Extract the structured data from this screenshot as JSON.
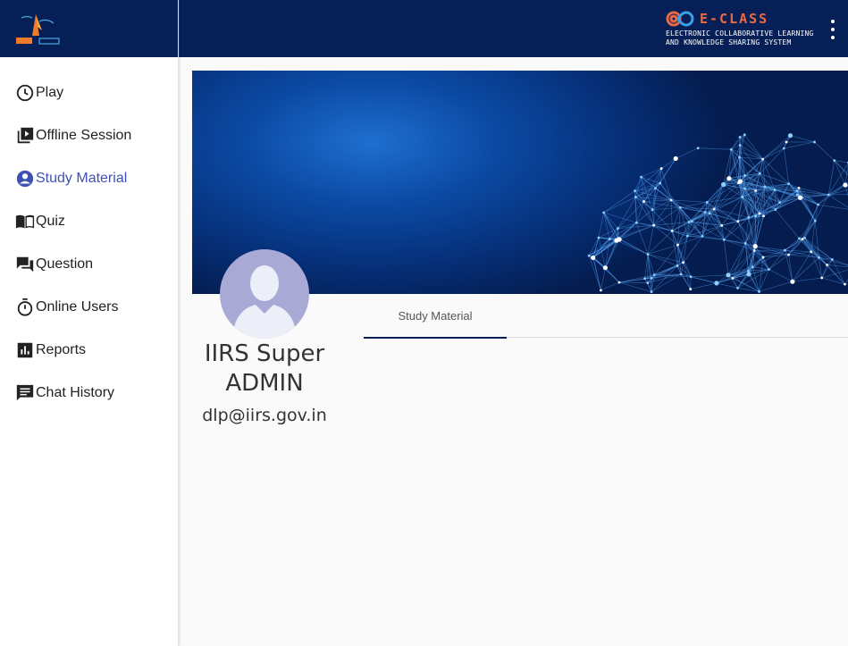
{
  "brand": {
    "title": "E-CLASS",
    "subtitle_line1": "ELECTRONIC COLLABORATIVE LEARNING",
    "subtitle_line2": "AND KNOWLEDGE SHARING SYSTEM"
  },
  "sidebar": {
    "items": [
      {
        "label": "Play",
        "icon": "clock-icon",
        "active": false
      },
      {
        "label": "Offline Session",
        "icon": "video-library-icon",
        "active": false
      },
      {
        "label": "Study Material",
        "icon": "account-circle-icon",
        "active": true
      },
      {
        "label": "Quiz",
        "icon": "book-icon",
        "active": false
      },
      {
        "label": "Question",
        "icon": "forum-icon",
        "active": false
      },
      {
        "label": "Online Users",
        "icon": "timer-icon",
        "active": false
      },
      {
        "label": "Reports",
        "icon": "bar-chart-icon",
        "active": false
      },
      {
        "label": "Chat History",
        "icon": "chat-icon",
        "active": false
      }
    ]
  },
  "profile": {
    "name": "IIRS Super ADMIN",
    "email": "dlp@iirs.gov.in"
  },
  "tabs": [
    {
      "label": "Study Material",
      "active": true
    }
  ],
  "colors": {
    "header_bg": "#062057",
    "active_nav": "#3f51b5",
    "brand_orange": "#ea6a45",
    "avatar_bg": "#a9a9d6"
  }
}
